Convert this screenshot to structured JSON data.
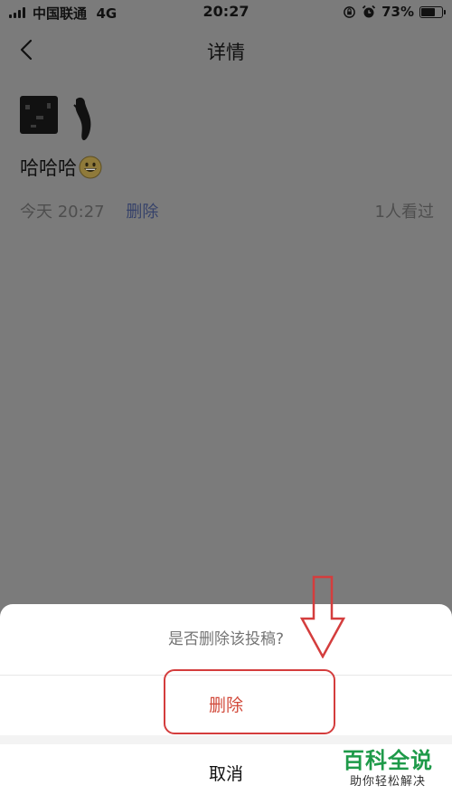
{
  "status_bar": {
    "carrier": "中国联通",
    "network": "4G",
    "time": "20:27",
    "battery": "73%",
    "battery_level": 0.73
  },
  "nav": {
    "title": "详情",
    "back_icon": "chevron-left-icon"
  },
  "post": {
    "text": "哈哈哈",
    "emoji": "grinning-face-emoji",
    "time": "今天 20:27",
    "delete_label": "删除",
    "views": "1人看过"
  },
  "action_sheet": {
    "title": "是否删除该投稿?",
    "delete_label": "删除",
    "cancel_label": "取消"
  },
  "annotation": {
    "highlight_color": "#d43d3d"
  },
  "watermark": {
    "title": "百科全说",
    "subtitle": "助你轻松解决"
  },
  "colors": {
    "overlay": "#7b7b7b",
    "destructive": "#d24a3b",
    "watermark": "#1e9a49"
  }
}
